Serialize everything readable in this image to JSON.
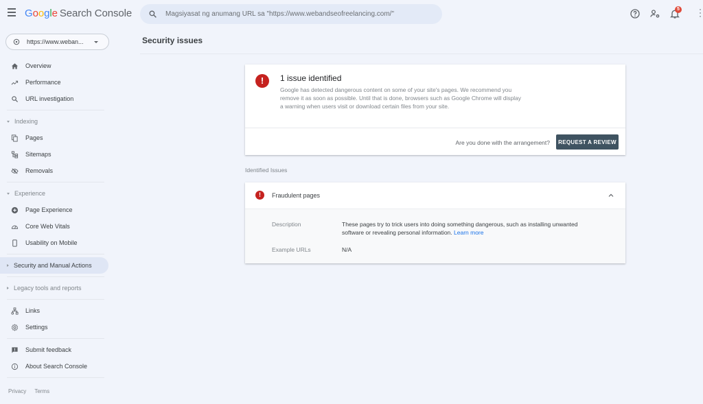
{
  "header": {
    "logo_letters": [
      "G",
      "o",
      "o",
      "g",
      "l",
      "e"
    ],
    "product_name": "Search Console",
    "search_placeholder": "Magsiyasat ng anumang URL sa \"https://www.webandseofreelancing.com/\"",
    "notification_count": "5",
    "icons": [
      "menu-icon",
      "search-icon",
      "help-icon",
      "manage-users-icon",
      "notifications-bell-icon",
      "more-vert-icon"
    ]
  },
  "property": {
    "url": "https://www.weban...",
    "icon": "globe-icon"
  },
  "sidebar": {
    "top_items": [
      {
        "label": "Overview",
        "icon": "home-icon"
      },
      {
        "label": "Performance",
        "icon": "trending-up-icon"
      },
      {
        "label": "URL investigation",
        "icon": "search-icon"
      }
    ],
    "indexing": {
      "label": "Indexing",
      "items": [
        {
          "label": "Pages",
          "icon": "pages-icon"
        },
        {
          "label": "Sitemaps",
          "icon": "sitemap-icon"
        },
        {
          "label": "Removals",
          "icon": "removals-icon"
        }
      ]
    },
    "experience": {
      "label": "Experience",
      "items": [
        {
          "label": "Page Experience",
          "icon": "page-experience-icon"
        },
        {
          "label": "Core Web Vitals",
          "icon": "speed-gauge-icon"
        },
        {
          "label": "Usability on Mobile",
          "icon": "mobile-icon"
        }
      ]
    },
    "security_section": "Security and Manual Actions",
    "legacy_section": "Legacy tools and reports",
    "bottom_items": [
      {
        "label": "Links",
        "icon": "links-icon"
      },
      {
        "label": "Settings",
        "icon": "gear-icon"
      }
    ],
    "help_items": [
      {
        "label": "Submit feedback",
        "icon": "feedback-icon"
      },
      {
        "label": "About Search Console",
        "icon": "info-icon"
      }
    ],
    "footer": {
      "privacy": "Privacy",
      "terms": "Terms"
    }
  },
  "main": {
    "page_title": "Security issues",
    "summary": {
      "title": "1 issue identified",
      "description": "Google has detected dangerous content on some of your site's pages. We recommend you remove it as soon as possible. Until that is done, browsers such as Google Chrome will display a warning when users visit or download certain files from your site.",
      "question": "Are you done with the arrangement?",
      "button": "REQUEST A REVIEW",
      "status_color": "#c5221f"
    },
    "identified_label": "Identified Issues",
    "issues": [
      {
        "name": "Fraudulent pages",
        "expanded": true,
        "description_label": "Description",
        "description": "These pages try to trick users into doing something dangerous, such as installing unwanted software or revealing personal information.",
        "learn_more": "Learn more",
        "example_urls_label": "Example URLs",
        "example_urls": "N/A"
      }
    ]
  }
}
